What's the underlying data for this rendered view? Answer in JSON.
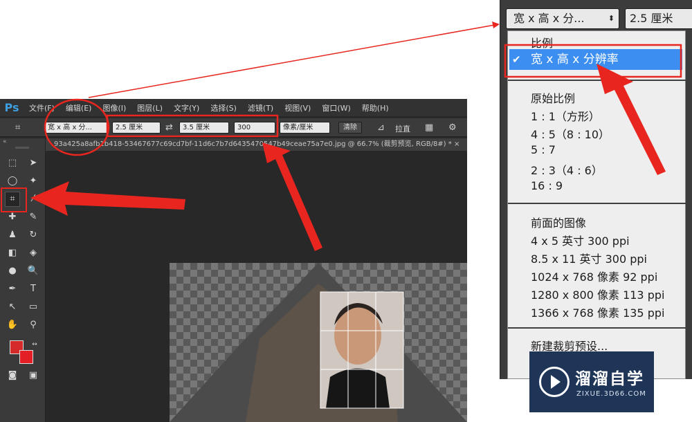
{
  "app": {
    "logo": "Ps",
    "menus": [
      "文件(F)",
      "编辑(E)",
      "图像(I)",
      "图层(L)",
      "文字(Y)",
      "选择(S)",
      "滤镜(T)",
      "视图(V)",
      "窗口(W)",
      "帮助(H)"
    ]
  },
  "options_bar": {
    "ratio_select": "宽 x 高 x 分...",
    "width": "2.5 厘米",
    "height": "3.5 厘米",
    "resolution": "300",
    "unit": "像素/厘米",
    "clear": "清除",
    "straighten": "拉直"
  },
  "document_tab": "93a425a8afb1b418-53467677c69cd7bf-11d6c7b7d6435470547b49ceae75a7e0.jpg @ 66.7% (裁剪预览, RGB/8#) * ×",
  "dropdown": {
    "select_value": "宽 x 高 x 分...",
    "input_value": "2.5 厘米",
    "items": [
      "比例",
      "宽 x 高 x 分辨率",
      "原始比例",
      "1 : 1（方形）",
      "4 : 5（8 : 10）",
      "5 : 7",
      "2 : 3（4 : 6）",
      "16 : 9",
      "前面的图像",
      "4 x 5 英寸 300 ppi",
      "8.5 x 11 英寸 300 ppi",
      "1024 x 768 像素 92 ppi",
      "1280 x 800 像素 113 ppi",
      "1366 x 768 像素 135 ppi",
      "新建裁剪预设..."
    ],
    "selected_index": 1
  },
  "watermark": {
    "name": "溜溜自学",
    "url": "ZIXUE.3D66.COM"
  },
  "colors": {
    "ps_dark": "#282828",
    "highlight": "#3c8ff0",
    "annotation_red": "#e8261f"
  }
}
